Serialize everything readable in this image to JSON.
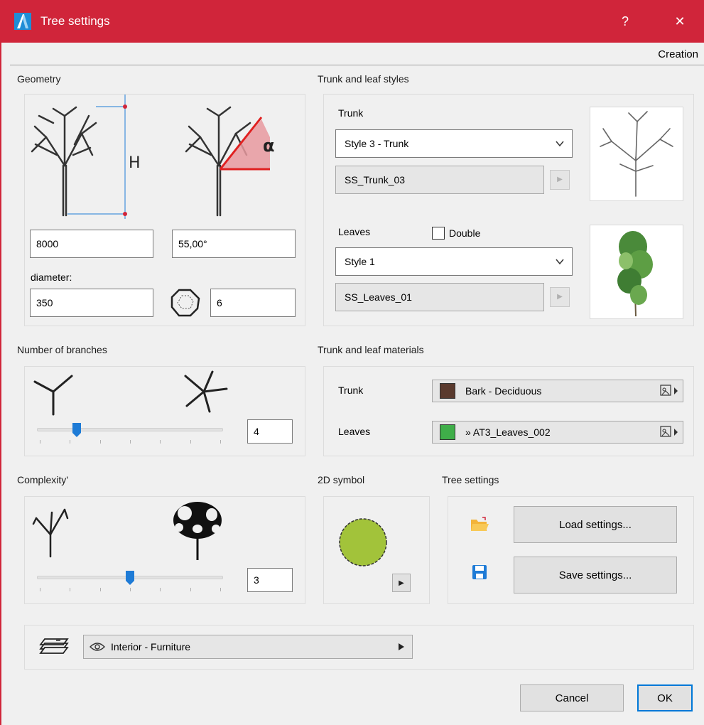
{
  "window": {
    "title": "Tree settings",
    "help": "?",
    "close": "✕",
    "accent": "#d0253a"
  },
  "mode_label": "Creation",
  "geometry": {
    "title": "Geometry",
    "height_value": "8000",
    "angle_value": "55,00°",
    "diameter_label": "diameter:",
    "diameter_value": "350",
    "sides_value": "6",
    "height_symbol": "H",
    "angle_symbol": "α"
  },
  "styles": {
    "title": "Trunk and leaf styles",
    "trunk_label": "Trunk",
    "trunk_style": "Style 3 - Trunk",
    "trunk_name": "SS_Trunk_03",
    "leaves_label": "Leaves",
    "double_label": "Double",
    "double_checked": false,
    "leaves_style": "Style 1",
    "leaves_name": "SS_Leaves_01"
  },
  "branches": {
    "title": "Number of branches",
    "value": "4",
    "slider_fraction": 0.2
  },
  "materials": {
    "title": "Trunk and leaf materials",
    "trunk_label": "Trunk",
    "trunk_material": "Bark - Deciduous",
    "trunk_color": "#5a3a2e",
    "leaves_label": "Leaves",
    "leaves_material": "» AT3_Leaves_002",
    "leaves_color": "#3fae49"
  },
  "complexity": {
    "title": "Complexity'",
    "value": "3",
    "slider_fraction": 0.5
  },
  "symbol2d": {
    "title": "2D symbol",
    "fill_color": "#a2c33a"
  },
  "tree_settings": {
    "title": "Tree settings",
    "load_label": "Load settings...",
    "save_label": "Save settings..."
  },
  "layer": {
    "value": "Interior - Furniture"
  },
  "footer": {
    "cancel_label": "Cancel",
    "ok_label": "OK"
  },
  "icons": [
    "app-logo-icon",
    "help-icon",
    "close-icon",
    "chevron-down-icon",
    "play-arrow-icon",
    "folder-open-icon",
    "floppy-disk-icon",
    "eye-icon",
    "layers-icon",
    "polygon-sides-icon",
    "material-picker-icon"
  ]
}
